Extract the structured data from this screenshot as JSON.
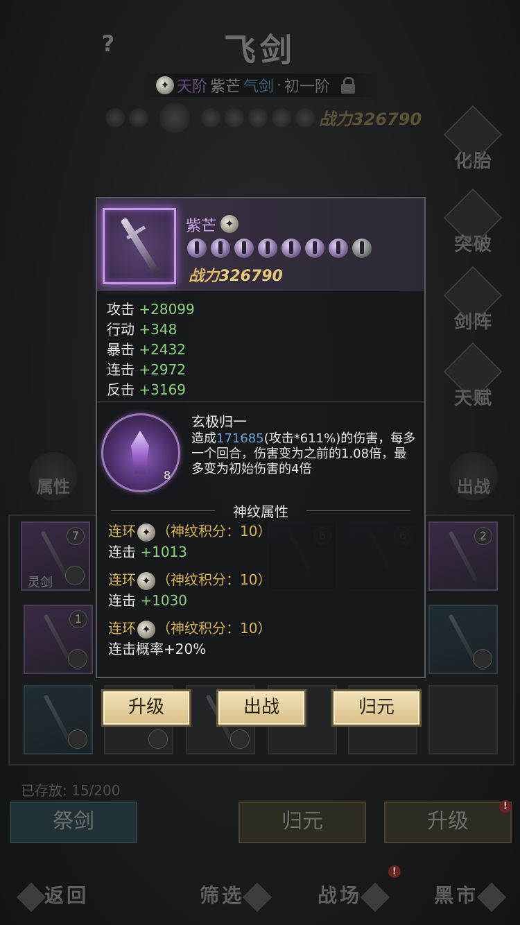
{
  "header": {
    "help": "?",
    "title": "飞剑",
    "rank": {
      "tier": "天阶",
      "name": "紫芒",
      "type": "气剑",
      "dot": "·",
      "stage": "初一阶"
    },
    "power_label": "战力",
    "power_value": "326790"
  },
  "right_menu": [
    {
      "label": "化胎"
    },
    {
      "label": "突破"
    },
    {
      "label": "剑阵"
    },
    {
      "label": "天赋"
    }
  ],
  "side": {
    "left_label": "属性",
    "right_label": "出战"
  },
  "grid": {
    "row1_counts": [
      "7",
      "6",
      "6",
      "2"
    ],
    "row2_counts": [
      "1"
    ],
    "lingjian_label": "灵剑"
  },
  "storage": {
    "label": "已存放:",
    "value": "15/200"
  },
  "bottom_buttons": {
    "left": "祭剑",
    "middle": "归元",
    "right": "升级",
    "badge": "!"
  },
  "nav": {
    "back": "返回",
    "filter": "筛选",
    "battle": "战场",
    "market": "黑市",
    "badge": "!"
  },
  "popup": {
    "name": "紫芒",
    "stars_total": 8,
    "stars_lit": 7,
    "power_label": "战力",
    "power_value": "326790",
    "attributes": [
      {
        "name": "攻击",
        "value": "+28099"
      },
      {
        "name": "行动",
        "value": "+348"
      },
      {
        "name": "暴击",
        "value": "+2432"
      },
      {
        "name": "连击",
        "value": "+2972"
      },
      {
        "name": "反击",
        "value": "+3169"
      }
    ],
    "skill": {
      "name": "玄极归一",
      "level": "8",
      "desc_prefix": "造成",
      "desc_value": "171685",
      "desc_rest": "(攻击*611%)的伤害，每多一个回合，伤害变为之前的1.08倍，最多变为初始伤害的4倍"
    },
    "rune_section_title": "神纹属性",
    "runes": [
      {
        "name": "连环",
        "score": "（神纹积分：10）",
        "stat": "连击",
        "value": "+1013"
      },
      {
        "name": "连环",
        "score": "（神纹积分：10）",
        "stat": "连击",
        "value": "+1030"
      },
      {
        "name": "连环",
        "score": "（神纹积分：10）",
        "stat": "连击概率",
        "value": "+20%"
      }
    ],
    "buttons": {
      "upgrade": "升级",
      "deploy": "出战",
      "return": "归元"
    }
  }
}
